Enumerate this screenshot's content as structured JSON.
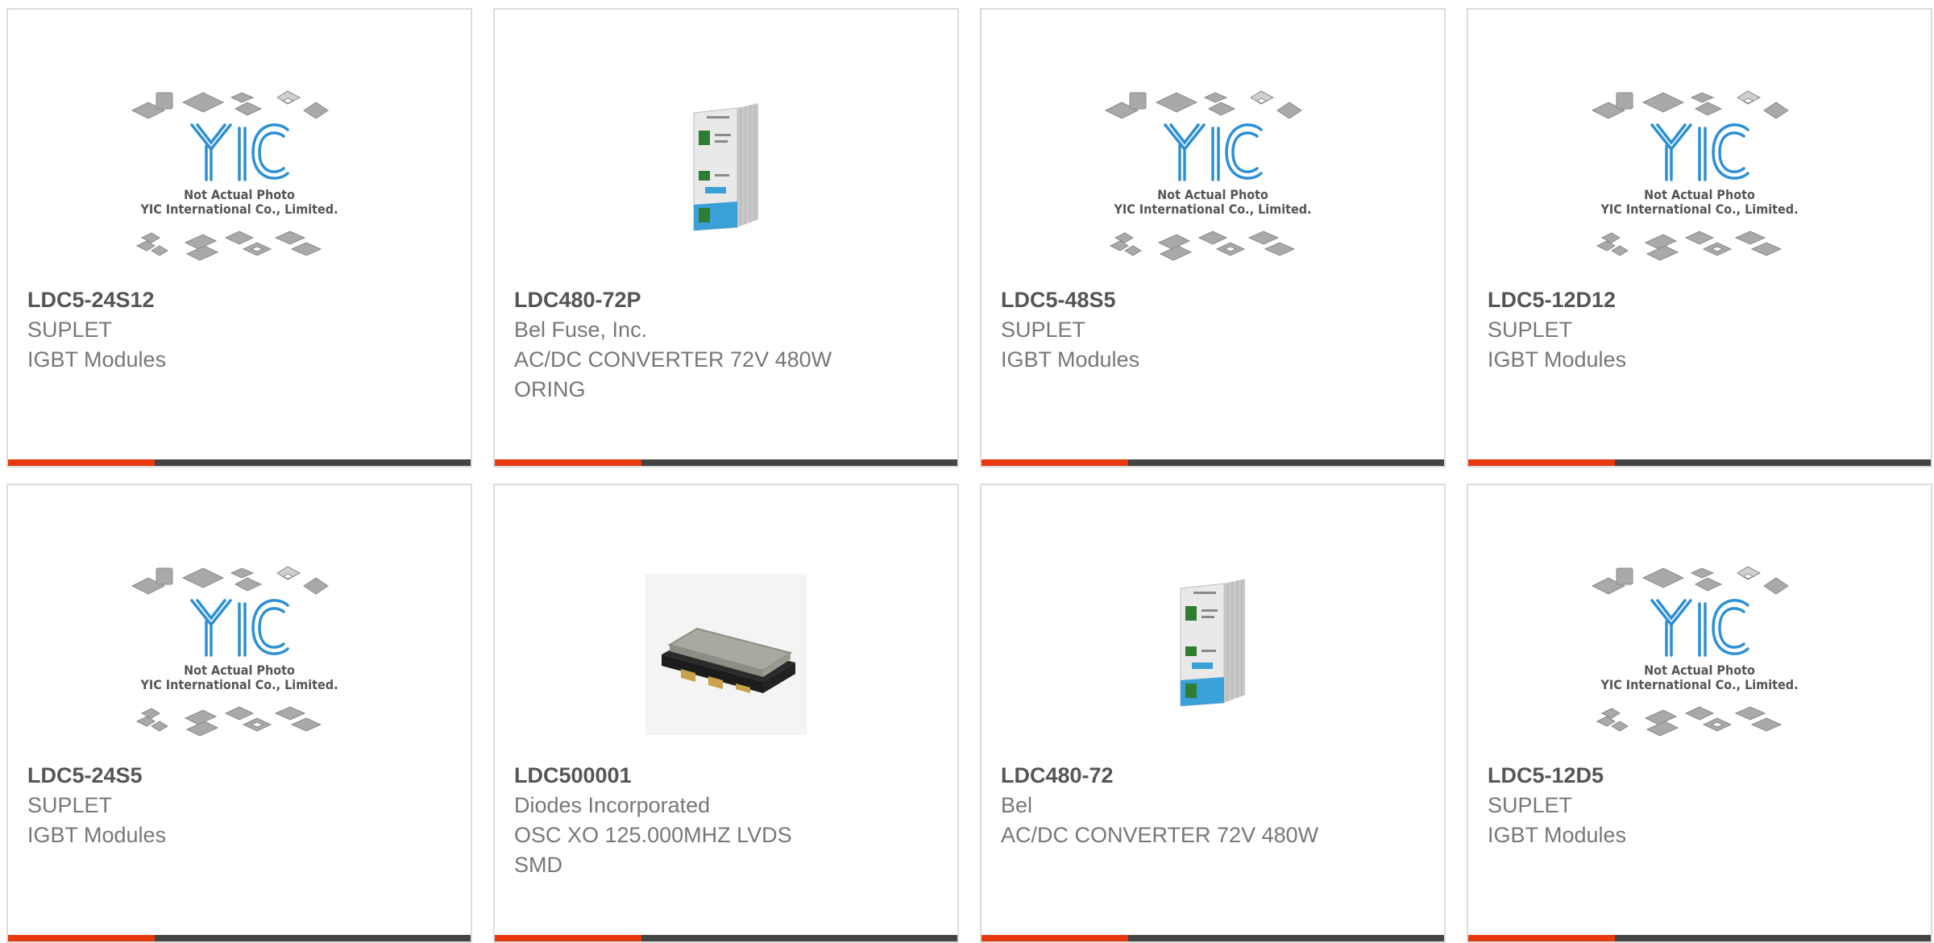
{
  "placeholder_image": {
    "logo_text": "YIC",
    "caption_line1": "Not Actual Photo",
    "caption_line2": "YIC International Co., Limited."
  },
  "colors": {
    "accent": "#e8390e",
    "bar": "#444444",
    "border": "#dcdcdc",
    "text": "#777777",
    "logo": "#2d8fd4"
  },
  "products": [
    {
      "part_number": "LDC5-24S12",
      "manufacturer": "SUPLET",
      "description": "IGBT Modules",
      "description2": "",
      "image": "placeholder"
    },
    {
      "part_number": "LDC480-72P",
      "manufacturer": "Bel Fuse, Inc.",
      "description": "AC/DC CONVERTER 72V 480W",
      "description2": "ORING",
      "image": "din-rail-power-supply"
    },
    {
      "part_number": "LDC5-48S5",
      "manufacturer": "SUPLET",
      "description": "IGBT Modules",
      "description2": "",
      "image": "placeholder"
    },
    {
      "part_number": "LDC5-12D12",
      "manufacturer": "SUPLET",
      "description": "IGBT Modules",
      "description2": "",
      "image": "placeholder"
    },
    {
      "part_number": "LDC5-24S5",
      "manufacturer": "SUPLET",
      "description": "IGBT Modules",
      "description2": "",
      "image": "placeholder"
    },
    {
      "part_number": "LDC500001",
      "manufacturer": "Diodes Incorporated",
      "description": "OSC XO 125.000MHZ LVDS",
      "description2": "SMD",
      "image": "smd-oscillator"
    },
    {
      "part_number": "LDC480-72",
      "manufacturer": "Bel",
      "description": "AC/DC CONVERTER 72V 480W",
      "description2": "",
      "image": "din-rail-power-supply"
    },
    {
      "part_number": "LDC5-12D5",
      "manufacturer": "SUPLET",
      "description": "IGBT Modules",
      "description2": "",
      "image": "placeholder"
    }
  ]
}
